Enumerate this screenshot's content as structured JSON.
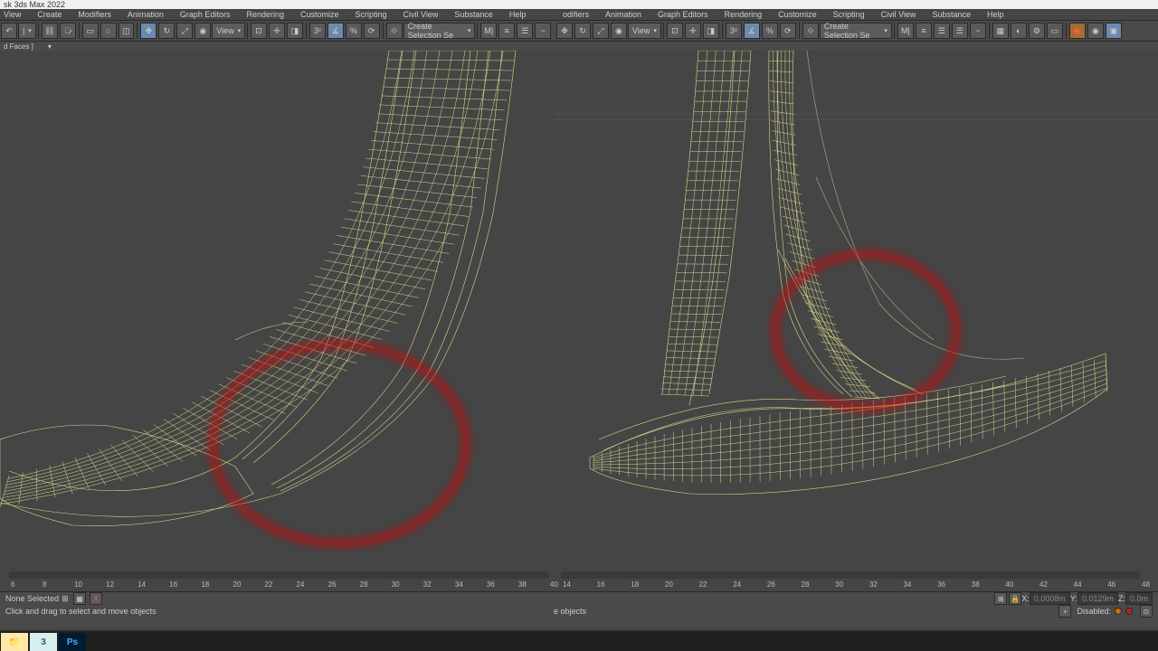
{
  "app": {
    "title": "sk 3ds Max 2022"
  },
  "menu_left": [
    "View",
    "Create",
    "Modifiers",
    "Animation",
    "Graph Editors",
    "Rendering",
    "Customize",
    "Scripting",
    "Civil View",
    "Substance",
    "Help"
  ],
  "menu_right": [
    "odifiers",
    "Animation",
    "Graph Editors",
    "Rendering",
    "Customize",
    "Scripting",
    "Civil View",
    "Substance",
    "Help"
  ],
  "toolbar": {
    "view_dropdown": "View",
    "selection_set": "Create Selection Se"
  },
  "sub_bar": {
    "label": "d Faces ]",
    "filter_icon": "▾"
  },
  "time_ticks_left": [
    6,
    8,
    10,
    12,
    14,
    16,
    18,
    20,
    22,
    24,
    26,
    28,
    30,
    32,
    34,
    36,
    38,
    40
  ],
  "time_ticks_right": [
    14,
    16,
    18,
    20,
    22,
    24,
    26,
    28,
    30,
    32,
    34,
    36,
    38,
    40,
    42,
    44,
    46,
    48
  ],
  "status": {
    "selection": "None Selected",
    "hint": "Click and drag to select and move objects",
    "right_hint": "e objects",
    "coord_x_label": "X:",
    "coord_x": "0.0008m",
    "coord_y_label": "Y:",
    "coord_y": "0.0129m",
    "coord_z_label": "Z:",
    "coord_z": "0.0m",
    "disabled": "Disabled:",
    "grid_label": "X",
    "grid_icon": "⊞"
  },
  "viewport": {
    "wire_color": "#d8d88a",
    "bg_color": "#454545",
    "annotation_color": "#c01010"
  },
  "taskbar_apps": [
    {
      "name": "explorer",
      "label": "📁"
    },
    {
      "name": "3dsmax",
      "label": "3"
    },
    {
      "name": "photoshop",
      "label": "Ps"
    }
  ]
}
